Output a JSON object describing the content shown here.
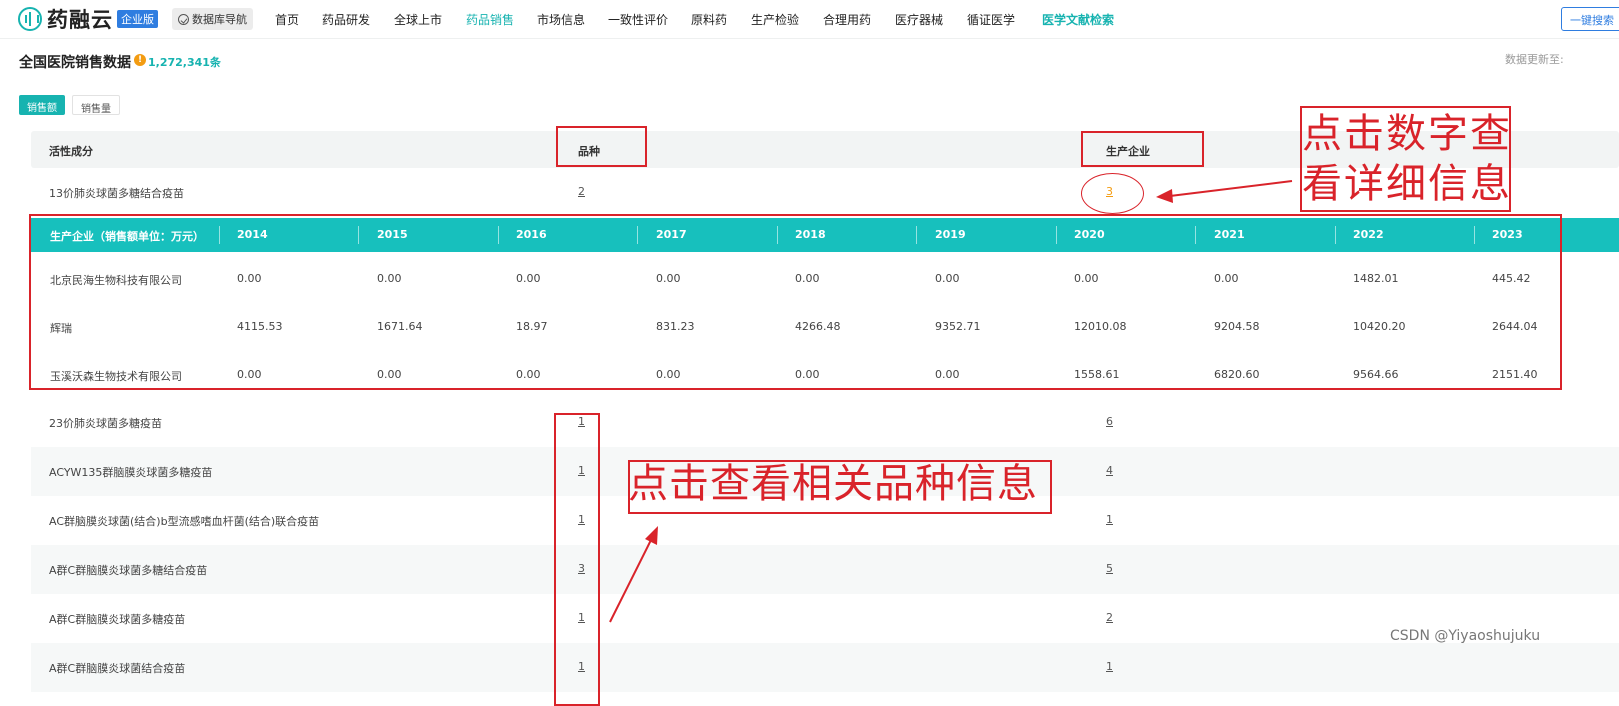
{
  "nav": {
    "logo_text": "药融云",
    "edition_badge": "企业版",
    "db_nav_label": "数据库导航",
    "items": [
      "首页",
      "药品研发",
      "全球上市",
      "药品销售",
      "市场信息",
      "一致性评价",
      "原料药",
      "生产检验",
      "合理用药",
      "医疗器械",
      "循证医学",
      "医学文献检索"
    ],
    "quick_search": "一键搜索"
  },
  "header": {
    "title": "全国医院销售数据",
    "record_count": "1,272,341条",
    "updated_label": "数据更新至:"
  },
  "tabs": [
    "销售额",
    "销售量"
  ],
  "table": {
    "columns": [
      "活性成分",
      "品种",
      "生产企业"
    ],
    "rows": [
      {
        "ingredient": "13价肺炎球菌多糖结合疫苗",
        "varieties": "2",
        "companies": "3"
      },
      {
        "ingredient": "23价肺炎球菌多糖疫苗",
        "varieties": "1",
        "companies": "6"
      },
      {
        "ingredient": "ACYW135群脑膜炎球菌多糖疫苗",
        "varieties": "1",
        "companies": "4"
      },
      {
        "ingredient": "AC群脑膜炎球菌(结合)b型流感嗜血杆菌(结合)联合疫苗",
        "varieties": "1",
        "companies": "1"
      },
      {
        "ingredient": "A群C群脑膜炎球菌多糖结合疫苗",
        "varieties": "3",
        "companies": "5"
      },
      {
        "ingredient": "A群C群脑膜炎球菌多糖疫苗",
        "varieties": "1",
        "companies": "2"
      },
      {
        "ingredient": "A群C群脑膜炎球菌结合疫苗",
        "varieties": "1",
        "companies": "1"
      }
    ]
  },
  "detail": {
    "header": [
      "生产企业（销售额单位：万元）",
      "2014",
      "2015",
      "2016",
      "2017",
      "2018",
      "2019",
      "2020",
      "2021",
      "2022",
      "2023"
    ],
    "rows": [
      [
        "北京民海生物科技有限公司",
        "0.00",
        "0.00",
        "0.00",
        "0.00",
        "0.00",
        "0.00",
        "0.00",
        "0.00",
        "1482.01",
        "445.42"
      ],
      [
        "辉瑞",
        "4115.53",
        "1671.64",
        "18.97",
        "831.23",
        "4266.48",
        "9352.71",
        "12010.08",
        "9204.58",
        "10420.20",
        "2644.04"
      ],
      [
        "玉溪沃森生物技术有限公司",
        "0.00",
        "0.00",
        "0.00",
        "0.00",
        "0.00",
        "0.00",
        "1558.61",
        "6820.60",
        "9564.66",
        "2151.40"
      ]
    ]
  },
  "annotations": {
    "click_number_line1": "点击数字查",
    "click_number_line2": "看详细信息",
    "click_variety": "点击查看相关品种信息"
  },
  "watermark": "CSDN @Yiyaoshujuku",
  "colors": {
    "accent": "#17b3b0",
    "annotation_red": "#d9232a",
    "badge_blue": "#2f7de0",
    "count_orange": "#f39c12"
  }
}
